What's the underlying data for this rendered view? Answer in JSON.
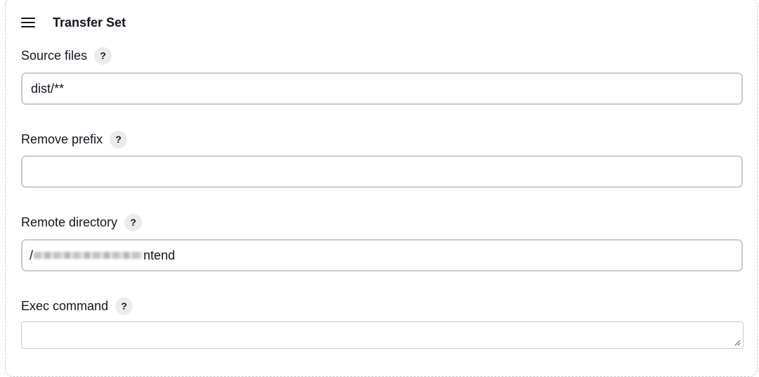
{
  "section": {
    "title": "Transfer Set"
  },
  "fields": {
    "source_files": {
      "label": "Source files",
      "value": "dist/**",
      "help": "?"
    },
    "remove_prefix": {
      "label": "Remove prefix",
      "value": "",
      "help": "?"
    },
    "remote_directory": {
      "label": "Remote directory",
      "value_prefix": "/",
      "value_suffix": "ntend",
      "help": "?"
    },
    "exec_command": {
      "label": "Exec command",
      "value": "",
      "help": "?"
    }
  }
}
